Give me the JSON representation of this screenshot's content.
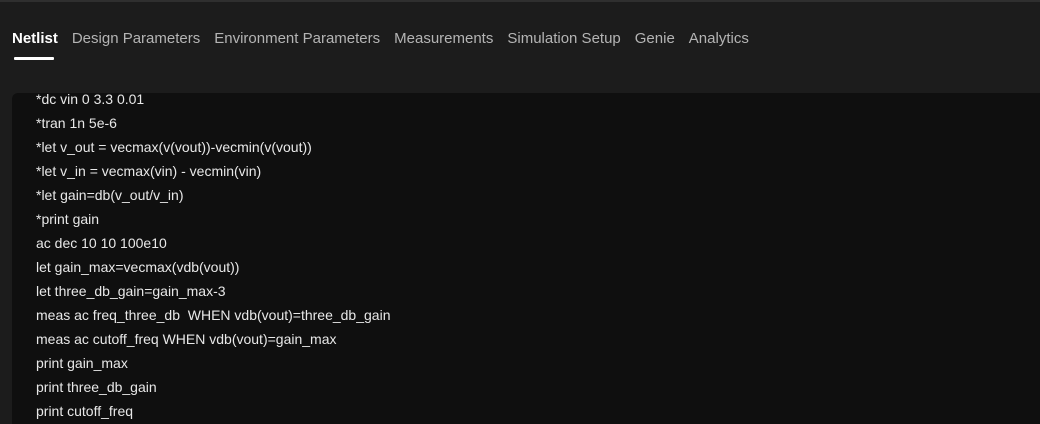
{
  "tabs": [
    {
      "label": "Netlist",
      "active": true
    },
    {
      "label": "Design Parameters"
    },
    {
      "label": "Environment Parameters"
    },
    {
      "label": "Measurements"
    },
    {
      "label": "Simulation Setup"
    },
    {
      "label": "Genie"
    },
    {
      "label": "Analytics"
    }
  ],
  "editor": {
    "lines": [
      "*dc vin 0 3.3 0.01",
      "*tran 1n 5e-6",
      "*let v_out = vecmax(v(vout))-vecmin(v(vout))",
      "*let v_in = vecmax(vin) - vecmin(vin)",
      "*let gain=db(v_out/v_in)",
      "*print gain",
      "ac dec 10 10 100e10",
      "let gain_max=vecmax(vdb(vout))",
      "let three_db_gain=gain_max-3",
      "meas ac freq_three_db  WHEN vdb(vout)=three_db_gain",
      "meas ac cutoff_freq WHEN vdb(vout)=gain_max",
      "print gain_max",
      "print three_db_gain",
      "print cutoff_freq"
    ]
  }
}
